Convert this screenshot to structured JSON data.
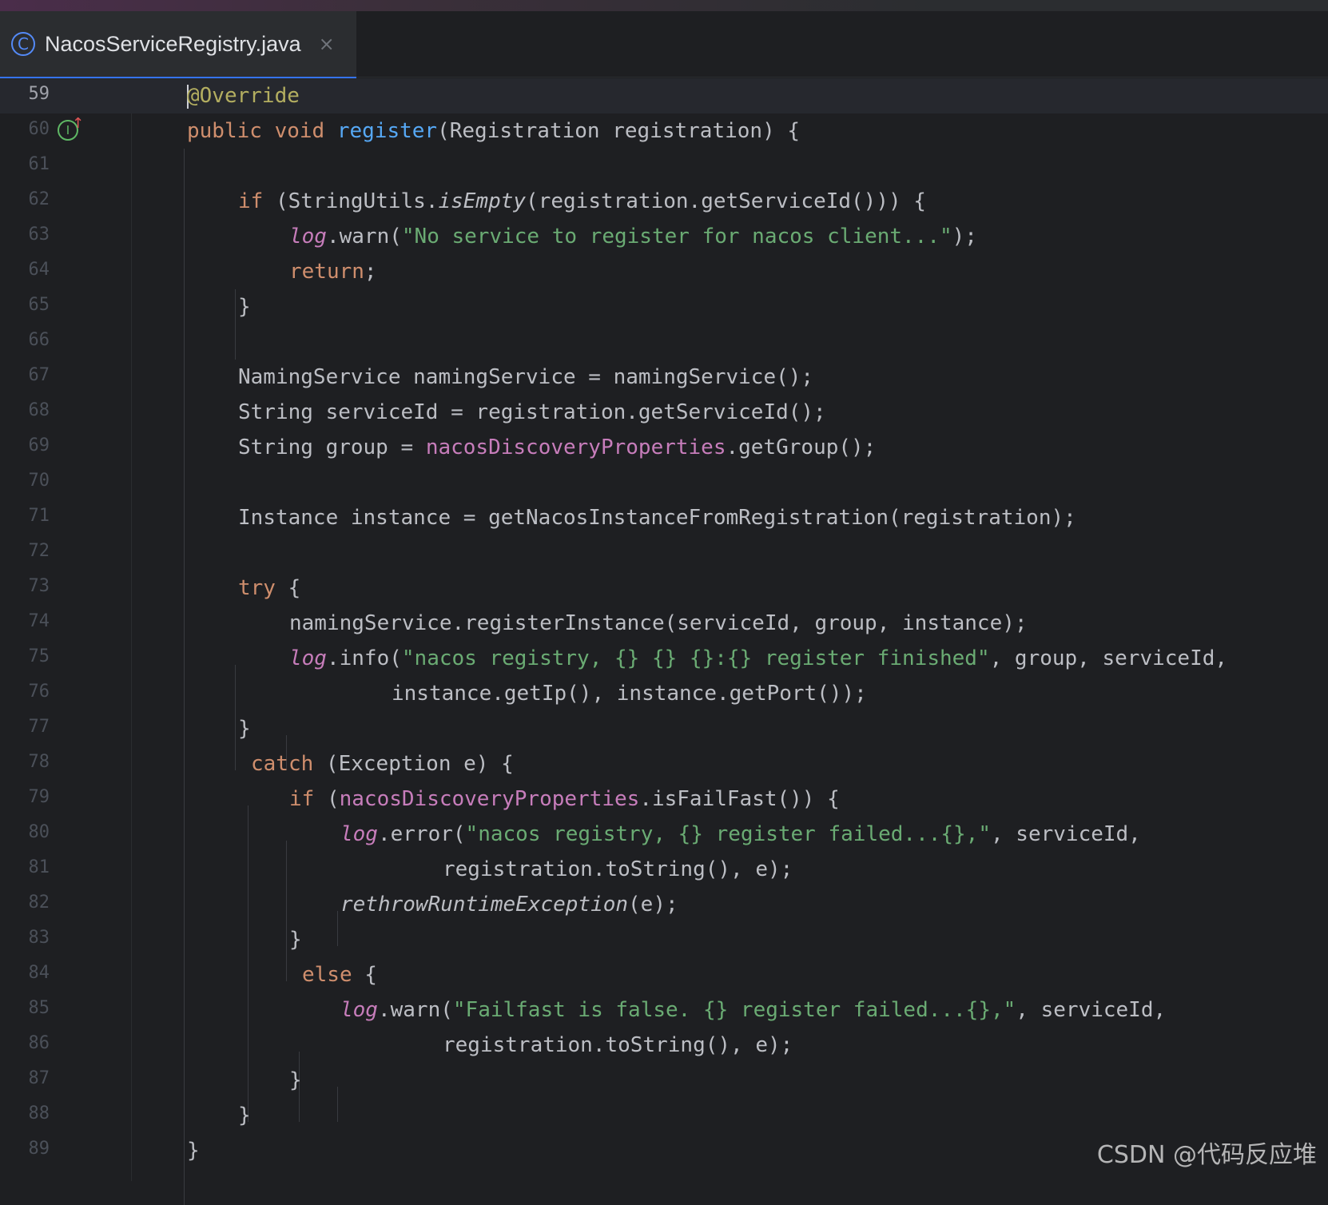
{
  "tab": {
    "title": "NacosServiceRegistry.java",
    "icon_glyph": "C",
    "close_glyph": "×"
  },
  "editor": {
    "current_line": "59",
    "gutter_icon_glyph": "I",
    "gutter_arrow_glyph": "↑",
    "lines": [
      {
        "num": "59"
      },
      {
        "num": "60"
      },
      {
        "num": "61"
      },
      {
        "num": "62"
      },
      {
        "num": "63"
      },
      {
        "num": "64"
      },
      {
        "num": "65"
      },
      {
        "num": "66"
      },
      {
        "num": "67"
      },
      {
        "num": "68"
      },
      {
        "num": "69"
      },
      {
        "num": "70"
      },
      {
        "num": "71"
      },
      {
        "num": "72"
      },
      {
        "num": "73"
      },
      {
        "num": "74"
      },
      {
        "num": "75"
      },
      {
        "num": "76"
      },
      {
        "num": "77"
      },
      {
        "num": "78"
      },
      {
        "num": "79"
      },
      {
        "num": "80"
      },
      {
        "num": "81"
      },
      {
        "num": "82"
      },
      {
        "num": "83"
      },
      {
        "num": "84"
      },
      {
        "num": "85"
      },
      {
        "num": "86"
      },
      {
        "num": "87"
      },
      {
        "num": "88"
      },
      {
        "num": "89"
      }
    ],
    "code": {
      "l59_ann": "@Override",
      "l60_kw": "public void ",
      "l60_fn": "register",
      "l60_rest": "(Registration registration) {",
      "l62_kw": "if",
      "l62_a": " (StringUtils.",
      "l62_it": "isEmpty",
      "l62_b": "(registration.getServiceId())) {",
      "l63_log": "log",
      "l63_a": ".warn(",
      "l63_str": "\"No service to register for nacos client...\"",
      "l63_b": ");",
      "l64_kw": "return",
      "l64_b": ";",
      "l65": "}",
      "l67": "NamingService namingService = namingService();",
      "l68": "String serviceId = registration.getServiceId();",
      "l69_a": "String group = ",
      "l69_fld": "nacosDiscoveryProperties",
      "l69_b": ".getGroup();",
      "l71": "Instance instance = getNacosInstanceFromRegistration(registration);",
      "l73_kw": "try",
      "l73_b": " {",
      "l74": "namingService.registerInstance(serviceId, group, instance);",
      "l75_log": "log",
      "l75_a": ".info(",
      "l75_str": "\"nacos registry, {} {} {}:{} register finished\"",
      "l75_b": ", group, serviceId,",
      "l76": "instance.getIp(), instance.getPort());",
      "l77": "}",
      "l78_kw": "catch",
      "l78_b": " (Exception e) {",
      "l79_kw": "if",
      "l79_a": " (",
      "l79_fld": "nacosDiscoveryProperties",
      "l79_b": ".isFailFast()) {",
      "l80_log": "log",
      "l80_a": ".error(",
      "l80_str": "\"nacos registry, {} register failed...{},\"",
      "l80_b": ", serviceId,",
      "l81": "registration.toString(), e);",
      "l82_it": "rethrowRuntimeException",
      "l82_b": "(e);",
      "l83": "}",
      "l84_kw": "else",
      "l84_b": " {",
      "l85_log": "log",
      "l85_a": ".warn(",
      "l85_str": "\"Failfast is false. {} register failed...{},\"",
      "l85_b": ", serviceId,",
      "l86": "registration.toString(), e);",
      "l87": "}",
      "l88": "}",
      "l89": "}"
    }
  },
  "watermark": "CSDN @代码反应堆",
  "colors": {
    "keyword": "#cf8e6d",
    "annotation": "#b3ae60",
    "function": "#56a8f5",
    "string": "#6aab73",
    "field": "#c77dbb",
    "text": "#bcbec4",
    "background": "#1e1f22",
    "tab_accent": "#3574f0"
  }
}
